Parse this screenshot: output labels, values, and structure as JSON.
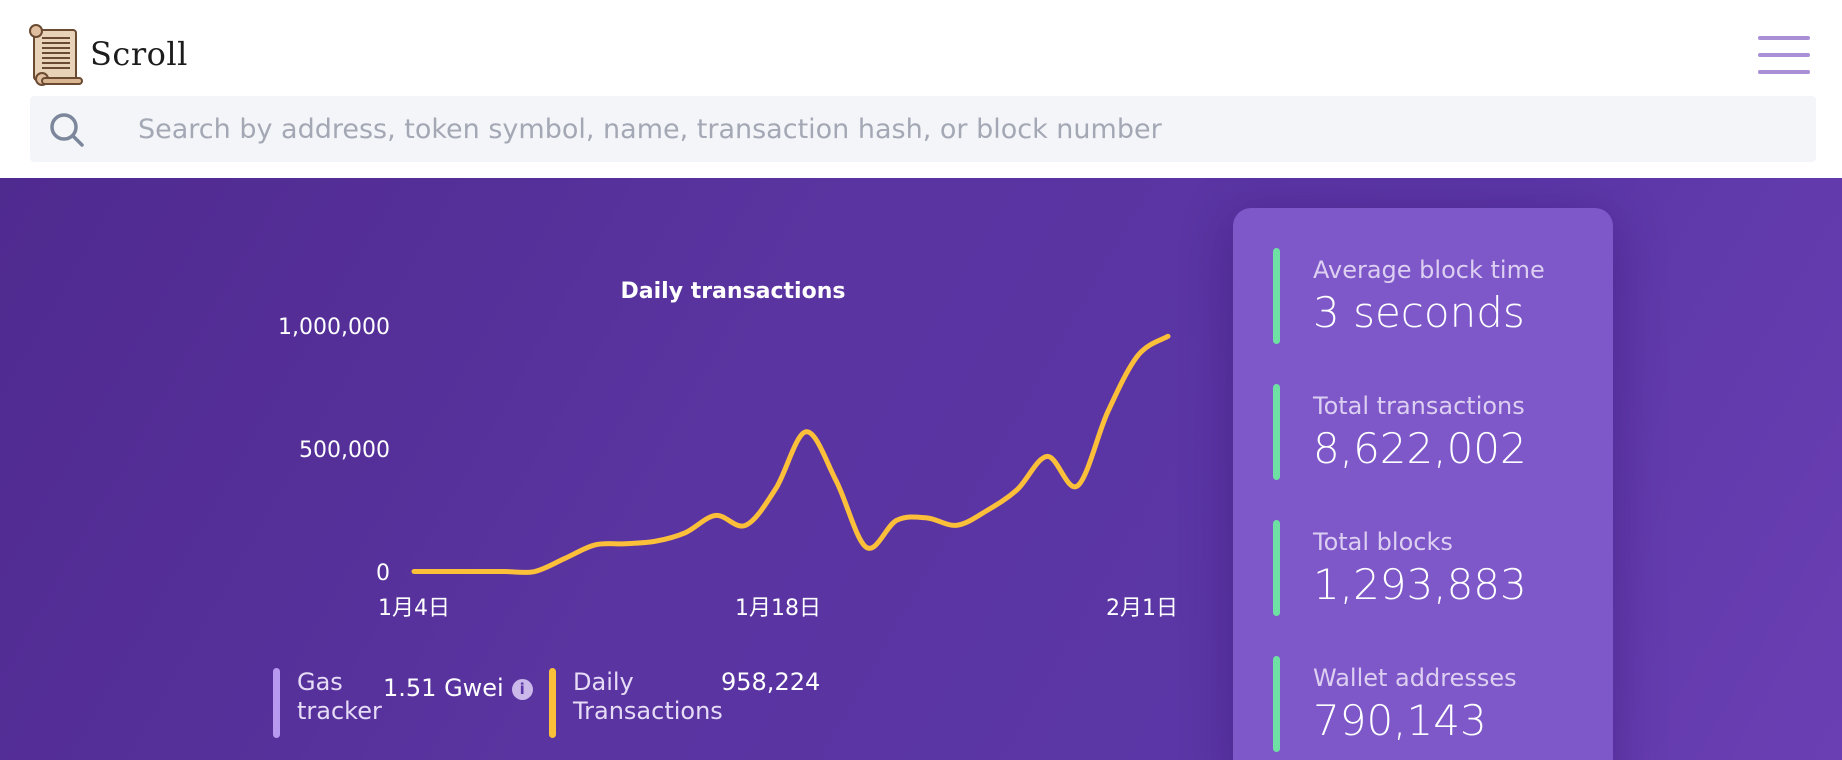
{
  "header": {
    "logo_text": "Scroll",
    "menu_icon": "hamburger-menu-icon"
  },
  "search": {
    "placeholder": "Search by address, token symbol, name, transaction hash, or block number",
    "icon": "search-icon"
  },
  "chart_data": {
    "type": "line",
    "title": "Daily transactions",
    "xlabel": "",
    "ylabel": "",
    "ylim": [
      0,
      1000000
    ],
    "yticks": [
      0,
      500000,
      1000000
    ],
    "ytick_labels": [
      "0",
      "500,000",
      "1,000,000"
    ],
    "xticks": [
      "1月4日",
      "1月18日",
      "2月1日"
    ],
    "xtick_days": [
      0,
      14,
      28
    ],
    "x": [
      "1月4日",
      "1月5日",
      "1月6日",
      "1月7日",
      "1月8日",
      "1月9日",
      "1月10日",
      "1月11日",
      "1月12日",
      "1月13日",
      "1月14日",
      "1月15日",
      "1月16日",
      "1月17日",
      "1月18日",
      "1月19日",
      "1月20日",
      "1月21日",
      "1月22日",
      "1月23日",
      "1月24日",
      "1月25日",
      "1月26日",
      "1月27日",
      "1月28日",
      "1月29日",
      "1月30日",
      "1月31日",
      "2月1日",
      "2月2日"
    ],
    "series": [
      {
        "color": "#fbbf39",
        "values": [
          2000,
          2000,
          2000,
          2000,
          2000,
          55000,
          110000,
          115000,
          125000,
          160000,
          230000,
          190000,
          340000,
          570000,
          370000,
          100000,
          210000,
          220000,
          190000,
          250000,
          335000,
          470000,
          350000,
          650000,
          880000,
          958224
        ]
      }
    ],
    "grid": false
  },
  "legend": {
    "gas": {
      "label_line1": "Gas",
      "label_line2": "tracker",
      "value": "1.51 Gwei",
      "color": "#b79af0"
    },
    "daily": {
      "label_line1": "Daily",
      "label_line2": "Transactions",
      "value": "958,224",
      "color": "#fbbf39"
    }
  },
  "stats": [
    {
      "label": "Average block time",
      "value": "3 seconds"
    },
    {
      "label": "Total transactions",
      "value": "8,622,002"
    },
    {
      "label": "Total blocks",
      "value": "1,293,883"
    },
    {
      "label": "Wallet addresses",
      "value": "790,143"
    }
  ],
  "colors": {
    "brand_purple": "#5b36a6",
    "card_purple": "#7e57c8",
    "accent_green": "#6fe0a4",
    "line_yellow": "#fbbf39",
    "search_bg": "#f3f5f9"
  }
}
